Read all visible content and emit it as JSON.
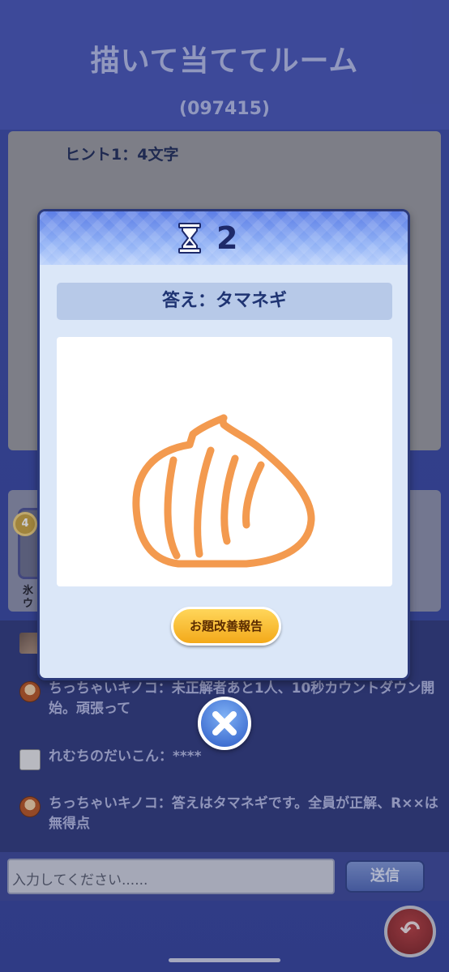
{
  "room": {
    "title": "描いて当ててルーム",
    "code": "(097415)"
  },
  "hint": {
    "text": "ヒント1：4文字"
  },
  "players": {
    "first_badge": "4",
    "first_name": "氷ウ"
  },
  "modal": {
    "timer_icon": "hourglass-icon",
    "timer_value": "2",
    "answer_label": "答え：タマネギ",
    "report_button": "お題改善報告",
    "close_icon": "close-icon"
  },
  "chat": {
    "messages": [
      {
        "avatar": "photo-avatar",
        "text": ""
      },
      {
        "avatar": "mushroom-avatar",
        "text": "ちっちゃいキノコ：未正解者あと1人、10秒カウントダウン開始。頑張って"
      },
      {
        "avatar": "drawing-avatar",
        "text": "れむちのだいこん：****"
      },
      {
        "avatar": "mushroom-avatar",
        "text": "ちっちゃいキノコ：答えはタマネギです。全員が正解、R××は無得点"
      }
    ]
  },
  "input": {
    "placeholder": "入力してください......",
    "send_label": "送信"
  },
  "nav": {
    "back_icon": "back-arrow-icon"
  },
  "colors": {
    "drawing_stroke": "#f39a4f",
    "accent_blue": "#2c5bc6",
    "report_yellow": "#f3a91a"
  }
}
